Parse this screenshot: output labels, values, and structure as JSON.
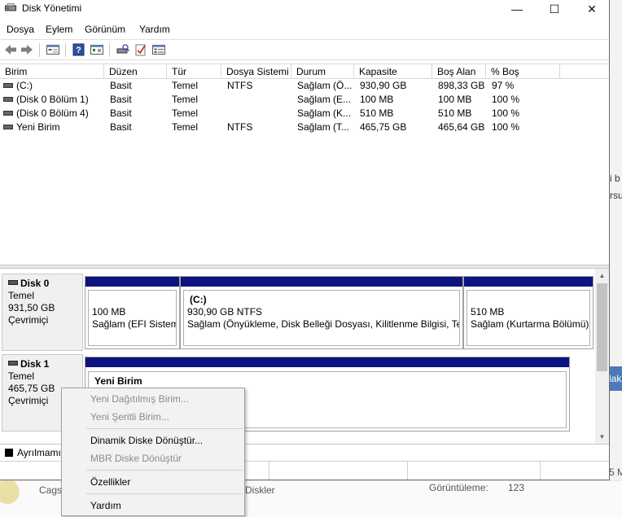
{
  "window": {
    "title": "Disk Yönetimi",
    "minimize_glyph": "—",
    "maximize_glyph": "☐",
    "close_glyph": "✕"
  },
  "menu": [
    "Dosya",
    "Eylem",
    "Görünüm",
    "Yardım"
  ],
  "toolbar_icons": [
    "back-arrow-icon",
    "forward-arrow-icon",
    "disk-list-icon",
    "help-icon",
    "refresh-view-icon",
    "rescan-disk-icon",
    "properties-check-icon",
    "settings-view-icon"
  ],
  "volume_table": {
    "columns": [
      "Birim",
      "Düzen",
      "Tür",
      "Dosya Sistemi",
      "Durum",
      "Kapasite",
      "Boş Alan",
      "% Boş"
    ],
    "rows": [
      {
        "name": " (C:)",
        "layout": "Basit",
        "type": "Temel",
        "fs": "NTFS",
        "status": "Sağlam (Ö...",
        "capacity": "930,90 GB",
        "free": "898,33 GB",
        "pct": "97 %"
      },
      {
        "name": "(Disk 0 Bölüm 1)",
        "layout": "Basit",
        "type": "Temel",
        "fs": "",
        "status": "Sağlam (E...",
        "capacity": "100 MB",
        "free": "100 MB",
        "pct": "100 %"
      },
      {
        "name": "(Disk 0 Bölüm 4)",
        "layout": "Basit",
        "type": "Temel",
        "fs": "",
        "status": "Sağlam (K...",
        "capacity": "510 MB",
        "free": "510 MB",
        "pct": "100 %"
      },
      {
        "name": "Yeni Birim",
        "layout": "Basit",
        "type": "Temel",
        "fs": "NTFS",
        "status": "Sağlam (T...",
        "capacity": "465,75 GB",
        "free": "465,64 GB",
        "pct": "100 %"
      }
    ]
  },
  "disks": [
    {
      "name": "Disk 0",
      "kind": "Temel",
      "size": "931,50 GB",
      "state": "Çevrimiçi",
      "partitions": [
        {
          "title": "",
          "line1": "100 MB",
          "line2": "Sağlam (EFI Sistem"
        },
        {
          "title": "(C:)",
          "line1": "930,90 GB NTFS",
          "line2": "Sağlam (Önyükleme, Disk Belleği Dosyası, Kilitlenme Bilgisi, Ten"
        },
        {
          "title": "",
          "line1": "510 MB",
          "line2": "Sağlam (Kurtarma Bölümü)"
        }
      ]
    },
    {
      "name": "Disk 1",
      "kind": "Temel",
      "size": "465,75 GB",
      "state": "Çevrimiçi",
      "partitions": [
        {
          "title": "Yeni Birim",
          "line1": "",
          "line2": ""
        }
      ]
    }
  ],
  "legend": {
    "label": "Ayrılmamı",
    "color": "#000000"
  },
  "context_menu": {
    "items": [
      {
        "label": "Yeni Dağıtılmış Birim...",
        "enabled": false
      },
      {
        "label": "Yeni Şeritli Birim...",
        "enabled": false
      },
      {
        "label": "Dinamik Diske Dönüştür...",
        "enabled": true
      },
      {
        "label": "MBR Diske Dönüştür",
        "enabled": false
      },
      {
        "label": "Özellikler",
        "enabled": true
      },
      {
        "label": "Yardım",
        "enabled": true
      }
    ]
  },
  "background": {
    "right_fragments": [
      "i b",
      "rsu"
    ],
    "button_fragment": "lak",
    "bottom_fragments": [
      "Cagsc",
      "Diskler",
      "Görüntüleme:",
      "123",
      "5 M"
    ]
  },
  "colors": {
    "partition_bar": "#0c1480",
    "accent_button": "#4a7ab8"
  }
}
